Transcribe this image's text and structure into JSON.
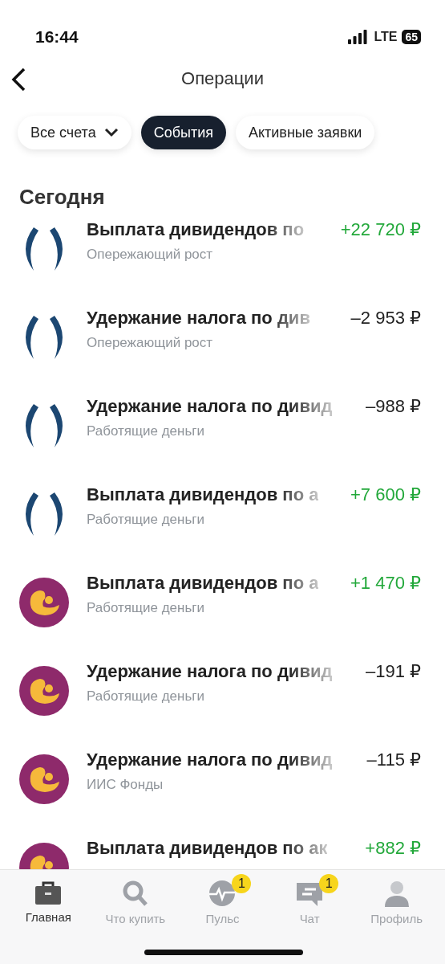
{
  "status_bar": {
    "time": "16:44",
    "network": "LTE",
    "battery": "65"
  },
  "header": {
    "title": "Операции"
  },
  "filters": [
    {
      "label": "Все счета",
      "kind": "dropdown",
      "selected": false
    },
    {
      "label": "События",
      "kind": "chip",
      "selected": true
    },
    {
      "label": "Активные заявки",
      "kind": "chip",
      "selected": false
    }
  ],
  "section": "Сегодня",
  "operations": [
    {
      "logo": {
        "kind": "brackets"
      },
      "kind": "income",
      "title": "Выплата дивидендов по",
      "account": "Опережающий рост",
      "amount": "+22 720 ₽"
    },
    {
      "logo": {
        "kind": "brackets"
      },
      "kind": "expense",
      "title": "Удержание налога по див",
      "account": "Опережающий рост",
      "amount": "–2 953 ₽"
    },
    {
      "logo": {
        "kind": "brackets"
      },
      "kind": "expense",
      "title": "Удержание налога по дивид",
      "account": "Работящие деньги",
      "amount": "–988 ₽"
    },
    {
      "logo": {
        "kind": "brackets"
      },
      "kind": "income",
      "title": "Выплата дивидендов по а",
      "account": "Работящие деньги",
      "amount": "+7 600 ₽"
    },
    {
      "logo": {
        "kind": "figure"
      },
      "kind": "income",
      "title": "Выплата дивидендов по а",
      "account": "Работящие деньги",
      "amount": "+1 470 ₽"
    },
    {
      "logo": {
        "kind": "figure"
      },
      "kind": "expense",
      "title": "Удержание налога по дивид",
      "account": "Работящие деньги",
      "amount": "–191 ₽"
    },
    {
      "logo": {
        "kind": "figure"
      },
      "kind": "expense",
      "title": "Удержание налога по дивид",
      "account": "ИИС Фонды",
      "amount": "–115 ₽"
    },
    {
      "logo": {
        "kind": "figure"
      },
      "kind": "income",
      "title": "Выплата дивидендов по ак",
      "amount": "+882 ₽"
    }
  ],
  "tab_bar": [
    {
      "label": "Главная",
      "selected": true
    },
    {
      "label": "Что купить",
      "selected": false
    },
    {
      "label": "Пульс",
      "selected": false,
      "badge": "1"
    },
    {
      "label": "Чат",
      "selected": false,
      "badge": "1"
    },
    {
      "label": "Профиль",
      "selected": false
    }
  ]
}
